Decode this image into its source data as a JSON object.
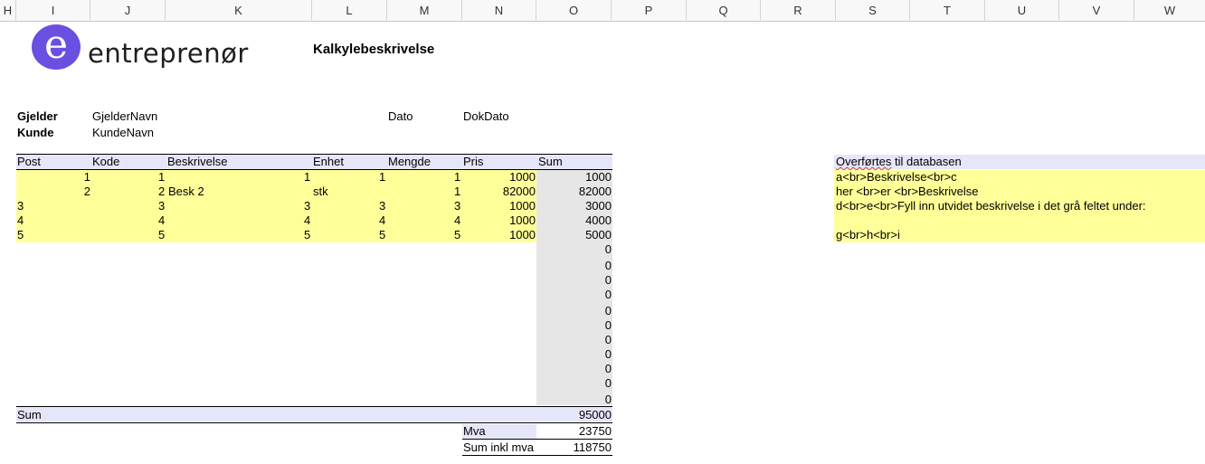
{
  "columns": [
    "H",
    "I",
    "J",
    "K",
    "L",
    "M",
    "N",
    "O",
    "P",
    "Q",
    "R",
    "S",
    "T",
    "U",
    "V",
    "W"
  ],
  "logo": {
    "mark": "e",
    "text": "entreprenør"
  },
  "title": "Kalkylebeskrivelse",
  "meta": {
    "gjelder_label": "Gjelder",
    "gjelder_value": "GjelderNavn",
    "kunde_label": "Kunde",
    "kunde_value": "KundeNavn",
    "dato_label": "Dato",
    "dato_value": "DokDato"
  },
  "table": {
    "headers": {
      "post": "Post",
      "kode": "Kode",
      "beskrivelse": "Beskrivelse",
      "enhet": "Enhet",
      "mengde": "Mengde",
      "pris": "Pris",
      "sum": "Sum"
    },
    "rows": [
      {
        "post": "1",
        "kode": "1",
        "beskrivelse": "",
        "enhet": "1",
        "mengde": "1",
        "pris": "1",
        "pris2": "1000",
        "sum": "1000"
      },
      {
        "post": "2",
        "kode": "2",
        "beskrivelse": "Besk 2",
        "enhet": "stk",
        "mengde": "",
        "pris": "1",
        "pris2": "82000",
        "sum": "82000"
      },
      {
        "post": "3",
        "kode": "3",
        "beskrivelse": "",
        "enhet": "3",
        "mengde": "3",
        "pris": "3",
        "pris2": "1000",
        "sum": "3000"
      },
      {
        "post": "4",
        "kode": "4",
        "beskrivelse": "",
        "enhet": "4",
        "mengde": "4",
        "pris": "4",
        "pris2": "1000",
        "sum": "4000"
      },
      {
        "post": "5",
        "kode": "5",
        "beskrivelse": "",
        "enhet": "5",
        "mengde": "5",
        "pris": "5",
        "pris2": "1000",
        "sum": "5000"
      }
    ],
    "empty_sums": [
      "0",
      "0",
      "0",
      "0",
      "0",
      "0",
      "0",
      "0",
      "0",
      "0",
      "0"
    ],
    "sum_label": "Sum",
    "sum_value": "95000",
    "mva_label": "Mva",
    "mva_value": "23750",
    "total_label": "Sum inkl mva",
    "total_value": "118750"
  },
  "database": {
    "header_word": "Overførtes",
    "header_rest": " til databasen",
    "lines": [
      "a<br>Beskrivelse<br>c",
      "her <br>er <br>Beskrivelse",
      "d<br>e<br>Fyll inn utvidet beskrivelse i det grå feltet under:",
      "",
      "g<br>h<br>i"
    ]
  }
}
